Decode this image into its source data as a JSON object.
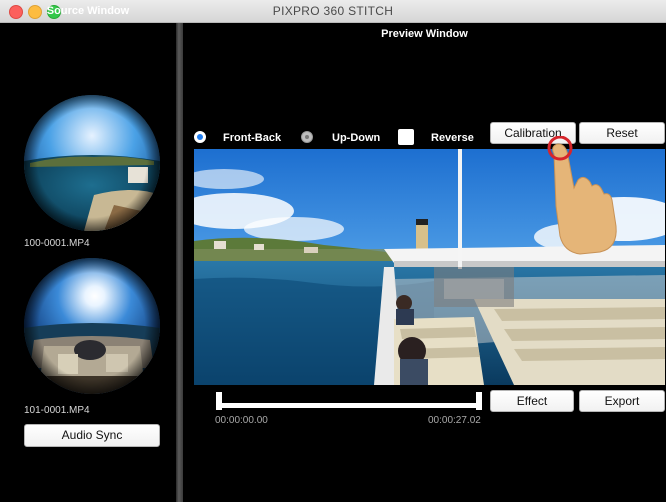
{
  "window": {
    "title": "PIXPRO 360 STITCH"
  },
  "source": {
    "title": "Source Window",
    "files": [
      {
        "name": "100-0001.MP4"
      },
      {
        "name": "101-0001.MP4"
      }
    ],
    "audio_sync_label": "Audio Sync"
  },
  "preview": {
    "title": "Preview Window",
    "options": {
      "front_back": {
        "label": "Front-Back",
        "selected": true
      },
      "up_down": {
        "label": "Up-Down",
        "selected": false
      },
      "reverse": {
        "label": "Reverse",
        "checked": false
      }
    },
    "buttons": {
      "calibration": "Calibration",
      "reset": "Reset",
      "effect": "Effect",
      "export": "Export"
    },
    "timeline": {
      "start": "00:00:00.00",
      "end": "00:00:27.02"
    }
  },
  "colors": {
    "accent": "#1f7df0",
    "calibration_highlight": "#d6262c"
  }
}
